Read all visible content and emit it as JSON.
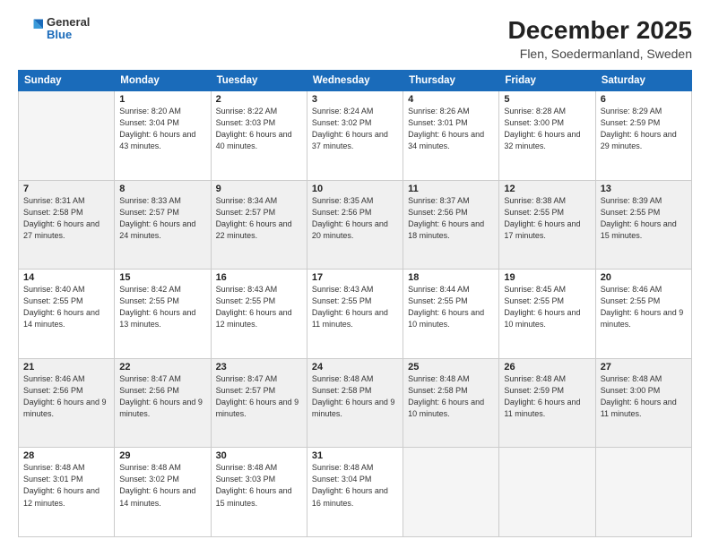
{
  "logo": {
    "line1": "General",
    "line2": "Blue"
  },
  "title": "December 2025",
  "subtitle": "Flen, Soedermanland, Sweden",
  "days_of_week": [
    "Sunday",
    "Monday",
    "Tuesday",
    "Wednesday",
    "Thursday",
    "Friday",
    "Saturday"
  ],
  "weeks": [
    [
      {
        "day": "",
        "sunrise": "",
        "sunset": "",
        "daylight": "",
        "empty": true
      },
      {
        "day": "1",
        "sunrise": "Sunrise: 8:20 AM",
        "sunset": "Sunset: 3:04 PM",
        "daylight": "Daylight: 6 hours and 43 minutes."
      },
      {
        "day": "2",
        "sunrise": "Sunrise: 8:22 AM",
        "sunset": "Sunset: 3:03 PM",
        "daylight": "Daylight: 6 hours and 40 minutes."
      },
      {
        "day": "3",
        "sunrise": "Sunrise: 8:24 AM",
        "sunset": "Sunset: 3:02 PM",
        "daylight": "Daylight: 6 hours and 37 minutes."
      },
      {
        "day": "4",
        "sunrise": "Sunrise: 8:26 AM",
        "sunset": "Sunset: 3:01 PM",
        "daylight": "Daylight: 6 hours and 34 minutes."
      },
      {
        "day": "5",
        "sunrise": "Sunrise: 8:28 AM",
        "sunset": "Sunset: 3:00 PM",
        "daylight": "Daylight: 6 hours and 32 minutes."
      },
      {
        "day": "6",
        "sunrise": "Sunrise: 8:29 AM",
        "sunset": "Sunset: 2:59 PM",
        "daylight": "Daylight: 6 hours and 29 minutes."
      }
    ],
    [
      {
        "day": "7",
        "sunrise": "Sunrise: 8:31 AM",
        "sunset": "Sunset: 2:58 PM",
        "daylight": "Daylight: 6 hours and 27 minutes."
      },
      {
        "day": "8",
        "sunrise": "Sunrise: 8:33 AM",
        "sunset": "Sunset: 2:57 PM",
        "daylight": "Daylight: 6 hours and 24 minutes."
      },
      {
        "day": "9",
        "sunrise": "Sunrise: 8:34 AM",
        "sunset": "Sunset: 2:57 PM",
        "daylight": "Daylight: 6 hours and 22 minutes."
      },
      {
        "day": "10",
        "sunrise": "Sunrise: 8:35 AM",
        "sunset": "Sunset: 2:56 PM",
        "daylight": "Daylight: 6 hours and 20 minutes."
      },
      {
        "day": "11",
        "sunrise": "Sunrise: 8:37 AM",
        "sunset": "Sunset: 2:56 PM",
        "daylight": "Daylight: 6 hours and 18 minutes."
      },
      {
        "day": "12",
        "sunrise": "Sunrise: 8:38 AM",
        "sunset": "Sunset: 2:55 PM",
        "daylight": "Daylight: 6 hours and 17 minutes."
      },
      {
        "day": "13",
        "sunrise": "Sunrise: 8:39 AM",
        "sunset": "Sunset: 2:55 PM",
        "daylight": "Daylight: 6 hours and 15 minutes."
      }
    ],
    [
      {
        "day": "14",
        "sunrise": "Sunrise: 8:40 AM",
        "sunset": "Sunset: 2:55 PM",
        "daylight": "Daylight: 6 hours and 14 minutes."
      },
      {
        "day": "15",
        "sunrise": "Sunrise: 8:42 AM",
        "sunset": "Sunset: 2:55 PM",
        "daylight": "Daylight: 6 hours and 13 minutes."
      },
      {
        "day": "16",
        "sunrise": "Sunrise: 8:43 AM",
        "sunset": "Sunset: 2:55 PM",
        "daylight": "Daylight: 6 hours and 12 minutes."
      },
      {
        "day": "17",
        "sunrise": "Sunrise: 8:43 AM",
        "sunset": "Sunset: 2:55 PM",
        "daylight": "Daylight: 6 hours and 11 minutes."
      },
      {
        "day": "18",
        "sunrise": "Sunrise: 8:44 AM",
        "sunset": "Sunset: 2:55 PM",
        "daylight": "Daylight: 6 hours and 10 minutes."
      },
      {
        "day": "19",
        "sunrise": "Sunrise: 8:45 AM",
        "sunset": "Sunset: 2:55 PM",
        "daylight": "Daylight: 6 hours and 10 minutes."
      },
      {
        "day": "20",
        "sunrise": "Sunrise: 8:46 AM",
        "sunset": "Sunset: 2:55 PM",
        "daylight": "Daylight: 6 hours and 9 minutes."
      }
    ],
    [
      {
        "day": "21",
        "sunrise": "Sunrise: 8:46 AM",
        "sunset": "Sunset: 2:56 PM",
        "daylight": "Daylight: 6 hours and 9 minutes."
      },
      {
        "day": "22",
        "sunrise": "Sunrise: 8:47 AM",
        "sunset": "Sunset: 2:56 PM",
        "daylight": "Daylight: 6 hours and 9 minutes."
      },
      {
        "day": "23",
        "sunrise": "Sunrise: 8:47 AM",
        "sunset": "Sunset: 2:57 PM",
        "daylight": "Daylight: 6 hours and 9 minutes."
      },
      {
        "day": "24",
        "sunrise": "Sunrise: 8:48 AM",
        "sunset": "Sunset: 2:58 PM",
        "daylight": "Daylight: 6 hours and 9 minutes."
      },
      {
        "day": "25",
        "sunrise": "Sunrise: 8:48 AM",
        "sunset": "Sunset: 2:58 PM",
        "daylight": "Daylight: 6 hours and 10 minutes."
      },
      {
        "day": "26",
        "sunrise": "Sunrise: 8:48 AM",
        "sunset": "Sunset: 2:59 PM",
        "daylight": "Daylight: 6 hours and 11 minutes."
      },
      {
        "day": "27",
        "sunrise": "Sunrise: 8:48 AM",
        "sunset": "Sunset: 3:00 PM",
        "daylight": "Daylight: 6 hours and 11 minutes."
      }
    ],
    [
      {
        "day": "28",
        "sunrise": "Sunrise: 8:48 AM",
        "sunset": "Sunset: 3:01 PM",
        "daylight": "Daylight: 6 hours and 12 minutes."
      },
      {
        "day": "29",
        "sunrise": "Sunrise: 8:48 AM",
        "sunset": "Sunset: 3:02 PM",
        "daylight": "Daylight: 6 hours and 14 minutes."
      },
      {
        "day": "30",
        "sunrise": "Sunrise: 8:48 AM",
        "sunset": "Sunset: 3:03 PM",
        "daylight": "Daylight: 6 hours and 15 minutes."
      },
      {
        "day": "31",
        "sunrise": "Sunrise: 8:48 AM",
        "sunset": "Sunset: 3:04 PM",
        "daylight": "Daylight: 6 hours and 16 minutes."
      },
      {
        "day": "",
        "sunrise": "",
        "sunset": "",
        "daylight": "",
        "empty": true
      },
      {
        "day": "",
        "sunrise": "",
        "sunset": "",
        "daylight": "",
        "empty": true
      },
      {
        "day": "",
        "sunrise": "",
        "sunset": "",
        "daylight": "",
        "empty": true
      }
    ]
  ]
}
